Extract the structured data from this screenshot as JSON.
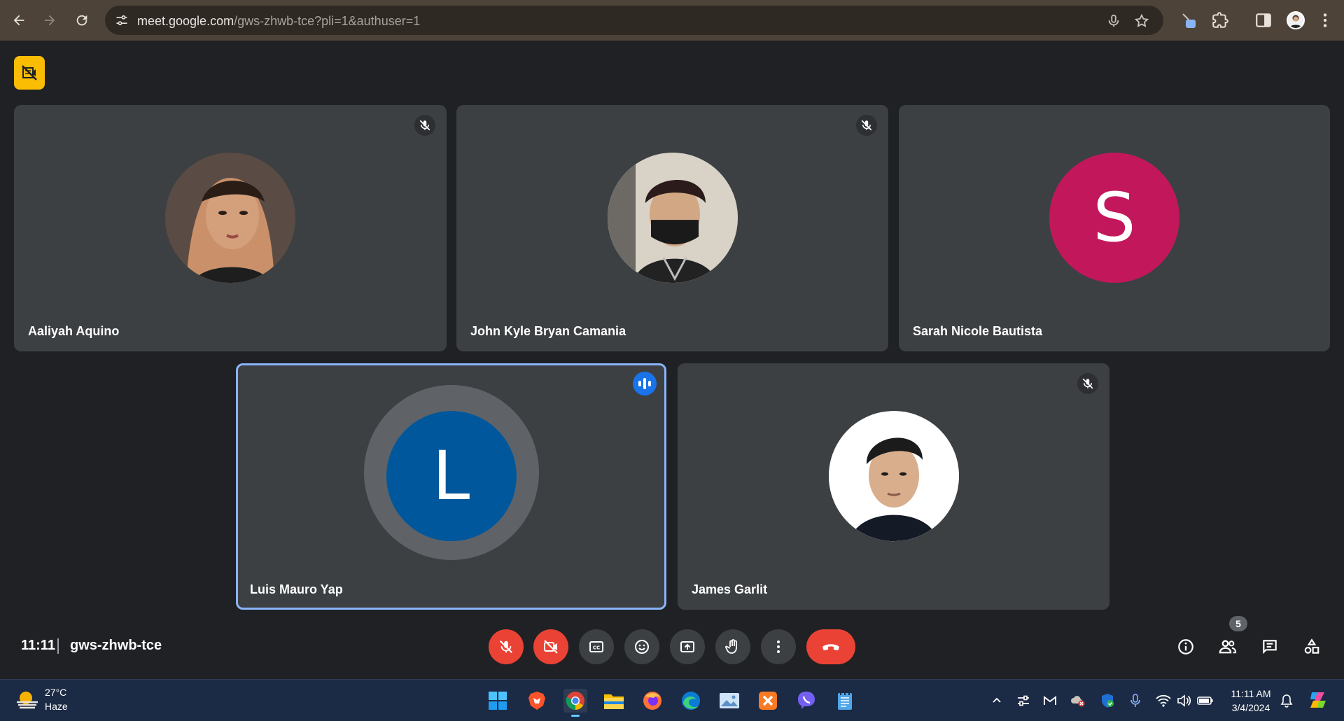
{
  "browser": {
    "url_host": "meet.google.com",
    "url_rest": "/gws-zhwb-tce?pli=1&authuser=1"
  },
  "participants": [
    {
      "name": "Aaliyah Aquino",
      "muted": true,
      "avatar": "photo"
    },
    {
      "name": "John Kyle Bryan Camania",
      "muted": true,
      "avatar": "photo"
    },
    {
      "name": "Sarah Nicole Bautista",
      "muted": false,
      "avatar": "initial",
      "initial": "S",
      "color": "#c2185b"
    },
    {
      "name": "Luis Mauro Yap",
      "speaking": true,
      "avatar": "initial",
      "initial": "L",
      "color": "#01579b"
    },
    {
      "name": "James Garlit",
      "muted": true,
      "avatar": "photo"
    }
  ],
  "meeting": {
    "time": "11:11",
    "code": "gws-zhwb-tce",
    "people_count": "5"
  },
  "taskbar": {
    "weather_temp": "27°C",
    "weather_status": "Haze",
    "time": "11:11 AM",
    "date": "3/4/2024"
  },
  "colors": {
    "stage": "#202124",
    "tile": "#3c4043",
    "danger": "#ea4335",
    "accent": "#8ab4f8",
    "rec_badge": "#fbbc04"
  }
}
